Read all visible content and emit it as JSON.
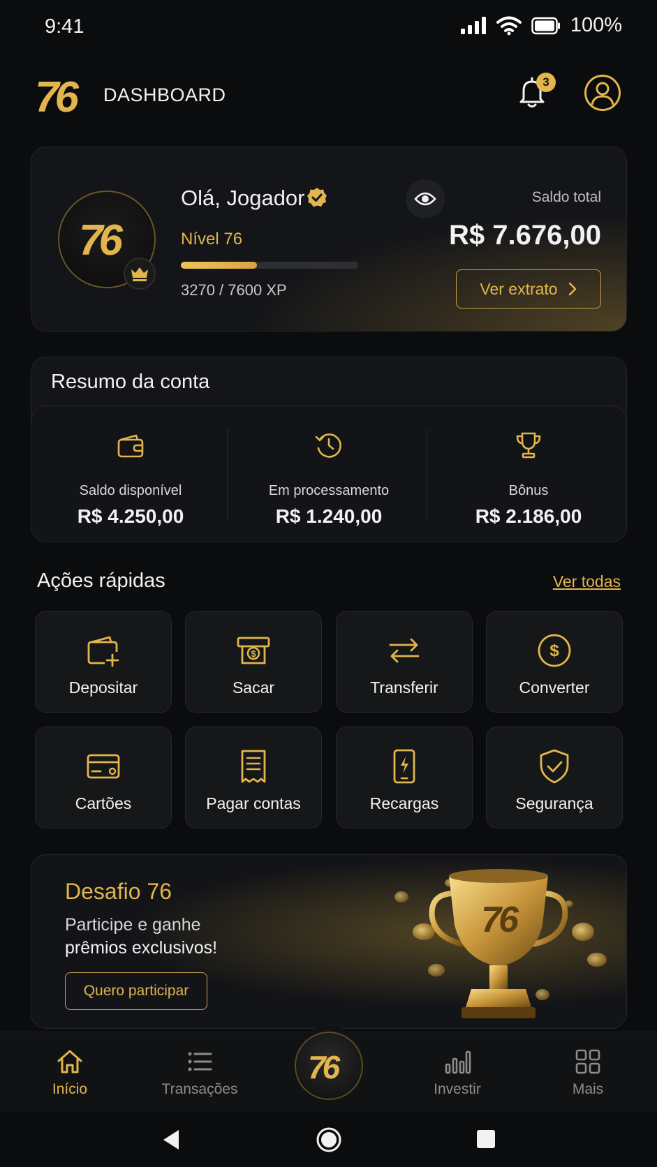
{
  "status_bar": {
    "time": "9:41",
    "battery": "100%"
  },
  "header": {
    "logo": "76",
    "title": "DASHBOARD",
    "notifications_count": "3"
  },
  "profile": {
    "avatar_logo": "76",
    "greeting": "Olá, Jogador",
    "level": "Nível 76",
    "xp_text": "3270 / 7600 XP",
    "xp_progress": 0.43,
    "balance_label": "Saldo total",
    "balance_value": "R$ 7.676,00",
    "statement_button": "Ver extrato"
  },
  "summary": {
    "title": "Resumo da conta",
    "items": [
      {
        "label": "Saldo disponível",
        "value": "R$ 4.250,00",
        "icon": "wallet-icon"
      },
      {
        "label": "Em processamento",
        "value": "R$ 1.240,00",
        "icon": "clock-history-icon"
      },
      {
        "label": "Bônus",
        "value": "R$ 2.186,00",
        "icon": "trophy-icon"
      }
    ]
  },
  "quick_actions": {
    "title": "Ações rápidas",
    "see_all": "Ver todas",
    "items": [
      {
        "label": "Depositar",
        "icon": "wallet-plus-icon"
      },
      {
        "label": "Sacar",
        "icon": "cash-withdraw-icon"
      },
      {
        "label": "Transferir",
        "icon": "transfer-arrows-icon"
      },
      {
        "label": "Converter",
        "icon": "dollar-coin-icon"
      },
      {
        "label": "Cartões",
        "icon": "credit-card-icon"
      },
      {
        "label": "Pagar contas",
        "icon": "receipt-icon"
      },
      {
        "label": "Recargas",
        "icon": "phone-charge-icon"
      },
      {
        "label": "Segurança",
        "icon": "shield-check-icon"
      }
    ]
  },
  "banner": {
    "title": "Desafio 76",
    "subtitle_line1": "Participe e ganhe",
    "subtitle_line2": "prêmios exclusivos!",
    "button": "Quero participar",
    "trophy_text": "76"
  },
  "bottom_nav": {
    "items": [
      {
        "label": "Início",
        "icon": "home-icon",
        "active": true
      },
      {
        "label": "Transações",
        "icon": "list-icon"
      },
      {
        "label": "Investir",
        "icon": "bar-chart-icon"
      },
      {
        "label": "Mais",
        "icon": "grid-icon"
      }
    ],
    "center_logo": "76"
  },
  "colors": {
    "accent": "#e2b54d",
    "background": "#0b0c0e",
    "card": "#141518"
  }
}
